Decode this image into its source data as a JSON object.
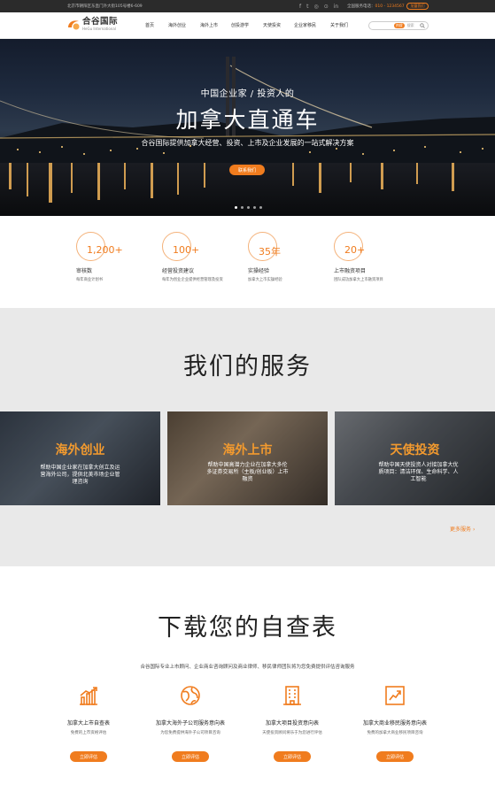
{
  "topbar": {
    "address": "北京市朝阳区东直门外大街105号楼6-609",
    "social_icons": [
      "facebook-icon",
      "twitter-icon",
      "wechat-icon",
      "weibo-icon",
      "linkedin-icon"
    ],
    "hotline_label": "全国服务电话：",
    "hotline_number": "010 - 1234567",
    "join_label": "加盟我们"
  },
  "header": {
    "logo_cn": "合谷国际",
    "logo_en": "HeGu International",
    "nav": [
      "首页",
      "海外创业",
      "海外上市",
      "创投游学",
      "天使投资",
      "企业家移民",
      "关于我们"
    ],
    "search_tag": "热搜",
    "search_keyword": "搜索"
  },
  "hero": {
    "subtitle": "中国企业家 / 投资人的",
    "title": "加拿大直通车",
    "description": "合谷国际提供加拿大经营、投资、上市及企业发展的一站式解决方案",
    "button": "联系我们",
    "slide_count": 5,
    "active_slide": 1
  },
  "stats": [
    {
      "number": "1,200+",
      "label": "审核数",
      "desc": "每年商业计划书"
    },
    {
      "number": "100+",
      "label": "经营投资建议",
      "desc": "每年为创业企业提供经营管理及投资"
    },
    {
      "number": "35年",
      "label": "实操经验",
      "desc": "加拿大上市实操经验"
    },
    {
      "number": "20+",
      "label": "上市融资项目",
      "desc": "团队成功加拿大上市融资项目"
    }
  ],
  "services": {
    "title": "我们的服务",
    "cards": [
      {
        "title": "海外创业",
        "desc_lines": [
          "帮助中国企业家在加拿大创立及运",
          "营海外公司，提供北美市场企业管",
          "理咨询"
        ]
      },
      {
        "title": "海外上市",
        "desc_lines": [
          "帮助中国高潜力企业在加拿大多伦",
          "多证券交易所（主板/创业板）上市",
          "融资"
        ]
      },
      {
        "title": "天使投资",
        "desc_lines": [
          "帮助中国天使投资人对接加拿大优",
          "质项目：清洁环保、生命科学、人",
          "工智能"
        ]
      }
    ],
    "more": "更多服务"
  },
  "download": {
    "title": "下载您的自查表",
    "description": "合谷国际专业上市顾问、企业商业咨询顾问及商业律师、移民律师团队将为您免费提供评估咨询服务",
    "items": [
      {
        "icon": "chart-icon",
        "title": "加拿大上市自查表",
        "desc": "免费的上市资格评估",
        "button": "立即评估"
      },
      {
        "icon": "globe-icon",
        "title": "加拿大海外子公司服务意向表",
        "desc": "为您免费提供海外子公司项目咨询",
        "button": "立即评估"
      },
      {
        "icon": "building-icon",
        "title": "加拿大项目投资意向表",
        "desc": "天使投资顾问将乐于为您进行评估",
        "button": "立即评估"
      },
      {
        "icon": "growth-icon",
        "title": "加拿大商业移民服务意向表",
        "desc": "免费的加拿大商业移民项目咨询",
        "button": "立即评估"
      }
    ]
  },
  "colors": {
    "accent": "#f07c1e",
    "topbar": "#2b2b2b",
    "service_bg": "#e9e9e9"
  }
}
